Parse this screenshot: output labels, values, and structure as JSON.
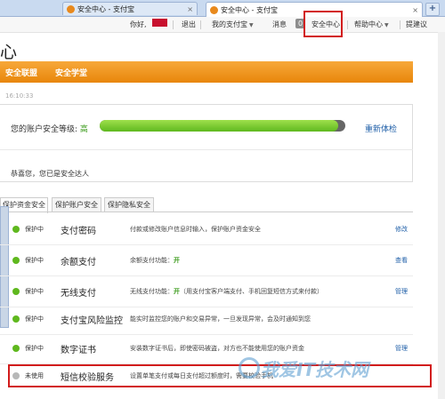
{
  "browser": {
    "tabs": [
      {
        "label": "安全中心 - 支付宝"
      },
      {
        "label": "安全中心 - 支付宝"
      }
    ],
    "new_tab_label": "+",
    "close_glyph": "×"
  },
  "topnav": {
    "greeting": "你好,",
    "logout": "退出",
    "my_alipay": "我的支付宝",
    "message": "消息",
    "message_count": "0",
    "security_center": "安全中心",
    "help_center": "帮助中心",
    "suggest": "提建议"
  },
  "page": {
    "title": "心",
    "orange_menu": [
      "安全联盟",
      "安全学堂"
    ],
    "date_text": "16:10:33",
    "security_level_label": "您的账户安全等级:",
    "security_level_value": "高",
    "security_level_progress": 0.97,
    "recheck": "重新体检",
    "congrats": "恭喜您，您已是安全达人"
  },
  "content_tabs": [
    "保护资金安全",
    "保护账户安全",
    "保护隐私安全"
  ],
  "rows": [
    {
      "status": "保护中",
      "service": "支付密码",
      "desc": "付款或修改账户信息时输入，保护账户资金安全",
      "action": "修改",
      "active": true
    },
    {
      "status": "保护中",
      "service": "余额支付",
      "desc_pre": "余额支付功能：",
      "desc_on": "开",
      "action": "查看",
      "active": true
    },
    {
      "status": "保护中",
      "service": "无线支付",
      "desc_pre": "无线支付功能：",
      "desc_on": "开",
      "desc_post": "（用支付宝客户端支付、手机回复短信方式来付款）",
      "action": "管理",
      "active": true
    },
    {
      "status": "保护中",
      "service": "支付宝风险监控",
      "desc": "能实时监控您的账户和交易异常，一旦发现异常，会及时通知到您",
      "action": "",
      "active": true
    },
    {
      "status": "保护中",
      "service": "数字证书",
      "desc": "安装数字证书后，即使密码被盗，对方也不能使用您的账户资金",
      "action": "管理",
      "active": true
    },
    {
      "status": "未使用",
      "service": "短信校验服务",
      "desc": "设置单笔支付或每日支付超过额度时，需要校验手机",
      "action": "",
      "active": false
    }
  ],
  "watermark": "我爱IT技术网",
  "colors": {
    "accent_orange": "#f29b2a",
    "progress_green": "#6dc423",
    "link_blue": "#1f5fa8",
    "highlight_red": "#d21c1c",
    "status_active": "#5fb81e",
    "status_inactive": "#b8b8b8"
  },
  "icons": {
    "tab_favicon": "alipay-shield-icon",
    "status_dot": "status-dot-icon",
    "dropdown": "chevron-down-icon"
  }
}
